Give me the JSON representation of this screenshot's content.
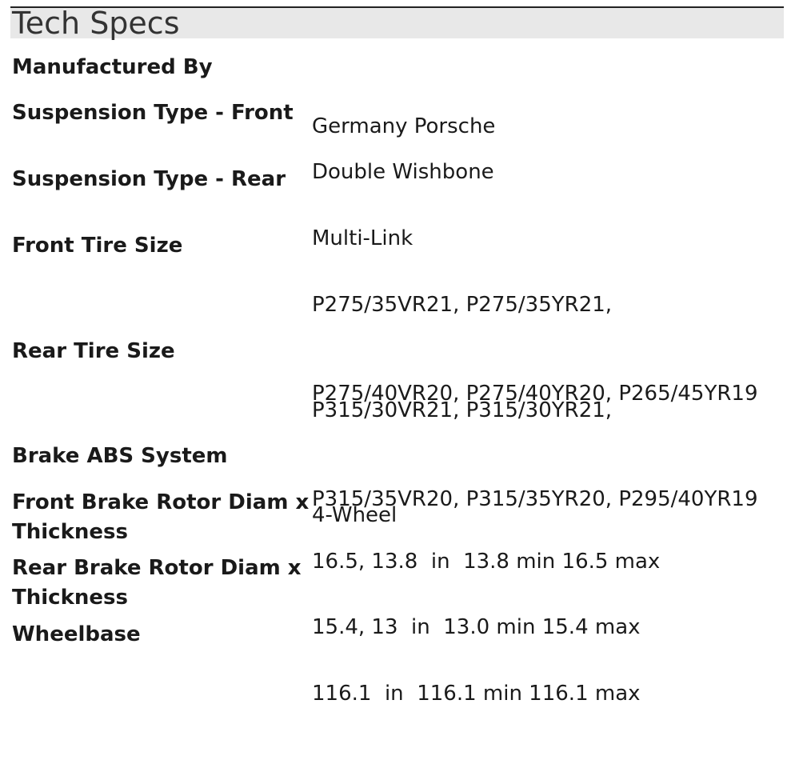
{
  "section": {
    "title": "Tech Specs"
  },
  "specs": [
    {
      "label": "Manufactured By",
      "value_lines": [
        "Germany Porsche"
      ]
    },
    {
      "label": "Suspension Type - Front",
      "value_lines": [
        "Double Wishbone"
      ]
    },
    {
      "label": "Suspension Type - Rear",
      "value_lines": [
        "Multi-Link"
      ]
    },
    {
      "label": "Front Tire Size",
      "value_lines": [
        "P275/35VR21, P275/35YR21,",
        "P275/40VR20, P275/40YR20, P265/45YR19"
      ]
    },
    {
      "label": "Rear Tire Size",
      "value_lines": [
        "P315/30VR21, P315/30YR21,",
        "P315/35VR20, P315/35YR20, P295/40YR19"
      ]
    },
    {
      "label": "Brake ABS System",
      "value_lines": [
        "4-Wheel"
      ]
    },
    {
      "label": "Front Brake Rotor Diam x Thickness",
      "value_lines": [
        "16.5, 13.8  in  13.8 min 16.5 max"
      ]
    },
    {
      "label": "Rear Brake Rotor Diam x Thickness",
      "value_lines": [
        "15.4, 13  in  13.0 min 15.4 max"
      ]
    },
    {
      "label": "Wheelbase",
      "value_lines": [
        "116.1  in  116.1 min 116.1 max"
      ]
    }
  ]
}
